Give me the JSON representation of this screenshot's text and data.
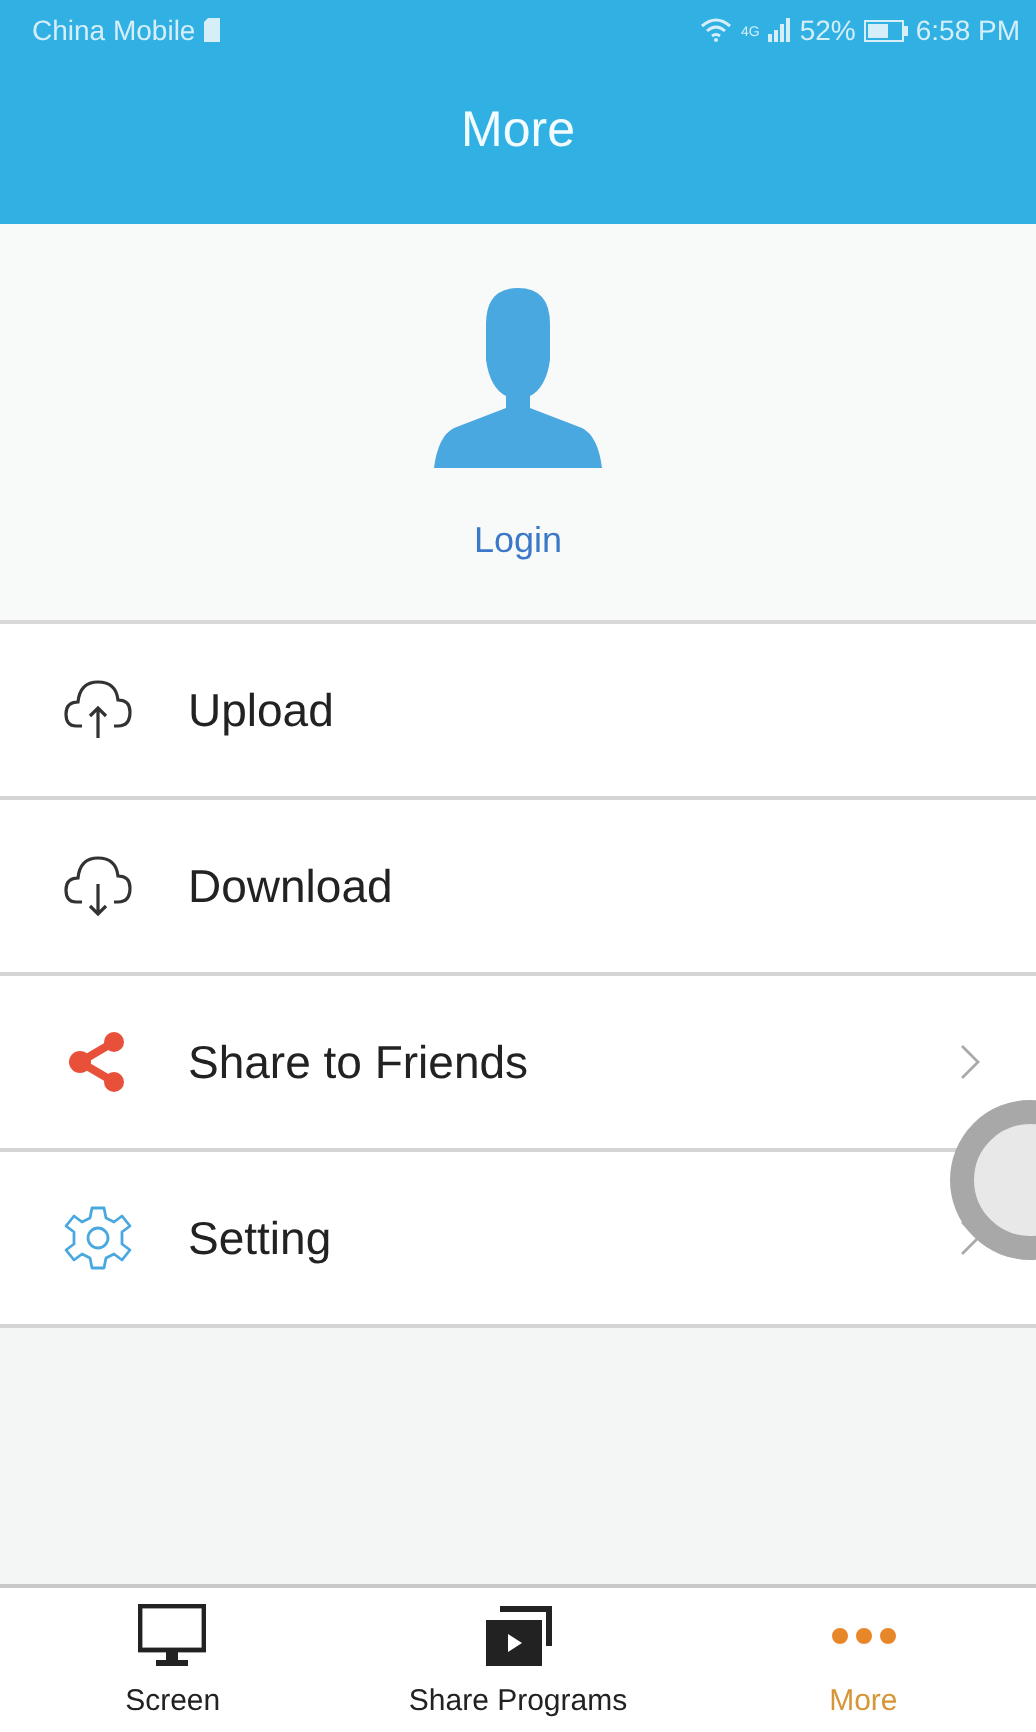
{
  "status_bar": {
    "carrier": "China Mobile",
    "network": "4G",
    "battery": "52%",
    "time": "6:58 PM"
  },
  "header": {
    "title": "More"
  },
  "profile": {
    "login": "Login"
  },
  "menu": [
    {
      "kind": "upload",
      "label": "Upload",
      "chevron": false
    },
    {
      "kind": "download",
      "label": "Download",
      "chevron": false
    },
    {
      "kind": "share",
      "label": "Share to Friends",
      "chevron": true
    },
    {
      "kind": "setting",
      "label": "Setting",
      "chevron": true
    }
  ],
  "tabs": [
    {
      "kind": "screen",
      "label": "Screen",
      "selected": false
    },
    {
      "kind": "programs",
      "label": "Share Programs",
      "selected": false
    },
    {
      "kind": "more",
      "label": "More",
      "selected": true
    }
  ]
}
